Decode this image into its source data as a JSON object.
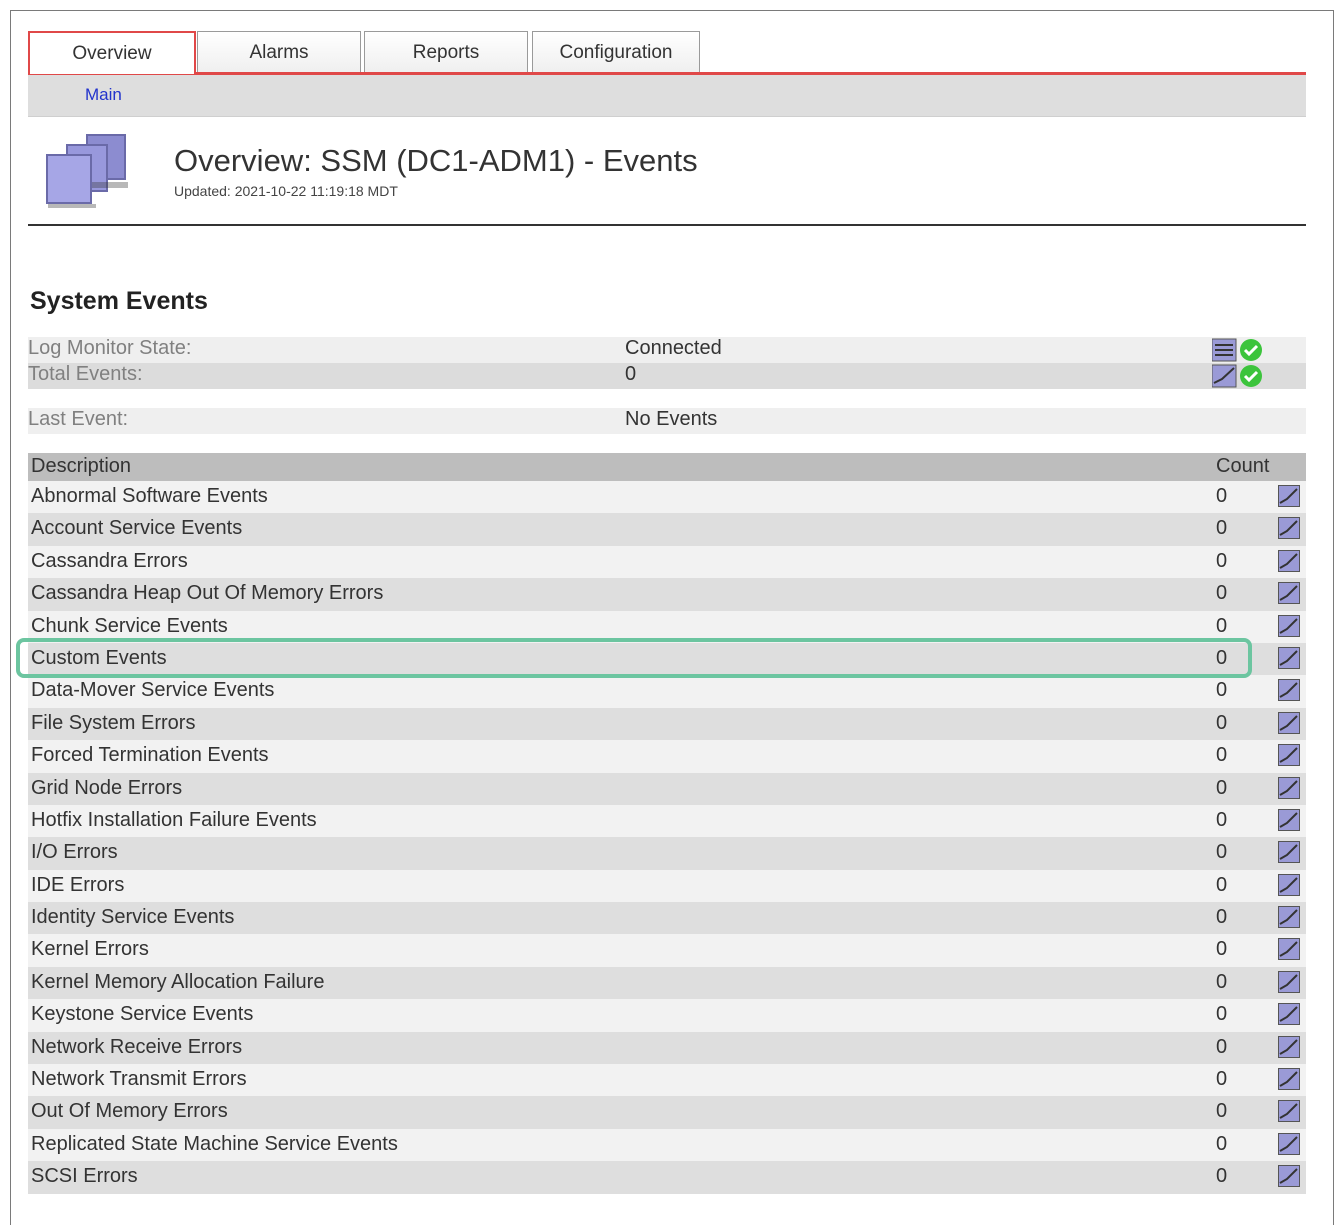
{
  "tabs": [
    {
      "label": "Overview",
      "active": true
    },
    {
      "label": "Alarms",
      "active": false
    },
    {
      "label": "Reports",
      "active": false
    },
    {
      "label": "Configuration",
      "active": false
    }
  ],
  "subnav": {
    "main_label": "Main"
  },
  "header": {
    "title": "Overview: SSM (DC1-ADM1) - Events",
    "updated": "Updated: 2021-10-22 11:19:18 MDT",
    "icon": "stacked-pages-icon"
  },
  "section_title": "System Events",
  "summary": {
    "log_monitor_state": {
      "label": "Log Monitor State:",
      "value": "Connected"
    },
    "total_events": {
      "label": "Total Events:",
      "value": "0"
    },
    "last_event": {
      "label": "Last Event:",
      "value": "No Events"
    }
  },
  "table": {
    "headers": {
      "description": "Description",
      "count": "Count"
    },
    "rows": [
      {
        "description": "Abnormal Software Events",
        "count": "0"
      },
      {
        "description": "Account Service Events",
        "count": "0"
      },
      {
        "description": "Cassandra Errors",
        "count": "0"
      },
      {
        "description": "Cassandra Heap Out Of Memory Errors",
        "count": "0"
      },
      {
        "description": "Chunk Service Events",
        "count": "0"
      },
      {
        "description": "Custom Events",
        "count": "0"
      },
      {
        "description": "Data-Mover Service Events",
        "count": "0"
      },
      {
        "description": "File System Errors",
        "count": "0"
      },
      {
        "description": "Forced Termination Events",
        "count": "0"
      },
      {
        "description": "Grid Node Errors",
        "count": "0"
      },
      {
        "description": "Hotfix Installation Failure Events",
        "count": "0"
      },
      {
        "description": "I/O Errors",
        "count": "0"
      },
      {
        "description": "IDE Errors",
        "count": "0"
      },
      {
        "description": "Identity Service Events",
        "count": "0"
      },
      {
        "description": "Kernel Errors",
        "count": "0"
      },
      {
        "description": "Kernel Memory Allocation Failure",
        "count": "0"
      },
      {
        "description": "Keystone Service Events",
        "count": "0"
      },
      {
        "description": "Network Receive Errors",
        "count": "0"
      },
      {
        "description": "Network Transmit Errors",
        "count": "0"
      },
      {
        "description": "Out Of Memory Errors",
        "count": "0"
      },
      {
        "description": "Replicated State Machine Service Events",
        "count": "0"
      },
      {
        "description": "SCSI Errors",
        "count": "0"
      }
    ]
  },
  "colors": {
    "accent_red": "#e04848",
    "highlight_green": "#6cc5a0",
    "status_green": "#3cc43c",
    "link_blue": "#2233cc"
  }
}
